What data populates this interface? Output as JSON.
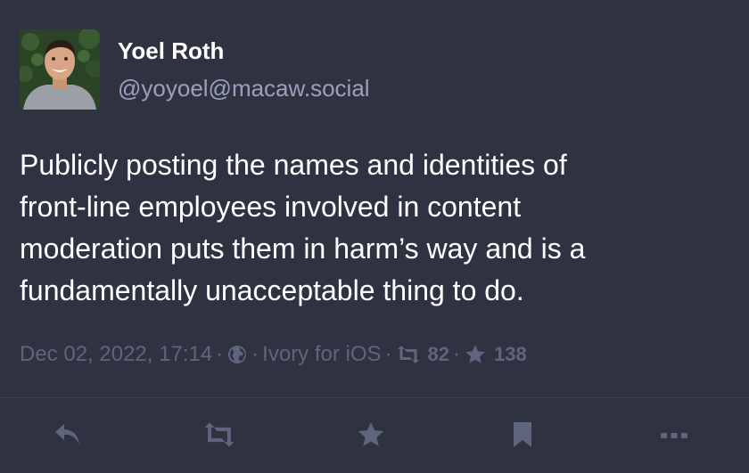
{
  "author": {
    "display_name": "Yoel Roth",
    "handle": "@yoyoel@macaw.social",
    "avatar_icon": "person-avatar"
  },
  "post": {
    "lines": [
      "Publicly posting the names and identities of",
      "front-line employees involved in content",
      "moderation puts them in harm’s way and is a",
      "fundamentally unacceptable thing to do."
    ]
  },
  "meta": {
    "timestamp": "Dec 02, 2022, 17:14",
    "separator": "·",
    "visibility_icon": "globe-icon",
    "client": "Ivory for iOS",
    "boost_icon": "boost-icon",
    "boost_count": "82",
    "favourite_icon": "star-icon",
    "favourite_count": "138"
  },
  "actions": {
    "icons": [
      "reply-icon",
      "boost-icon",
      "star-icon",
      "bookmark-icon",
      "more-icon"
    ]
  },
  "colors": {
    "background": "#2f3241",
    "text": "#ffffff",
    "secondary": "#9aa0be",
    "muted": "#60657e",
    "divider": "#393d4f"
  }
}
